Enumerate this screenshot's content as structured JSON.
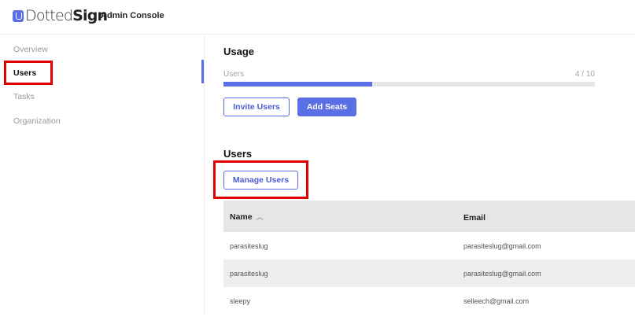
{
  "header": {
    "logo_part1": "Dotted",
    "logo_part2": "Sign",
    "console_label": "Admin Console"
  },
  "sidebar": {
    "items": [
      {
        "label": "Overview",
        "active": false
      },
      {
        "label": "Users",
        "active": true
      },
      {
        "label": "Tasks",
        "active": false
      },
      {
        "label": "Organization",
        "active": false
      }
    ]
  },
  "usage": {
    "title": "Usage",
    "label": "Users",
    "count_text": "4 / 10",
    "fraction": 0.4,
    "invite_button": "Invite Users",
    "add_seats_button": "Add Seats"
  },
  "users_section": {
    "title": "Users",
    "manage_button": "Manage Users",
    "columns": {
      "name": "Name",
      "email": "Email"
    },
    "sort_glyph": "︿",
    "rows": [
      {
        "name": "parasiteslug",
        "email": "parasiteslug@gmail.com"
      },
      {
        "name": "parasiteslug",
        "email": "parasiteslug@gmail.com"
      },
      {
        "name": "sleepy",
        "email": "selleech@gmail.com"
      }
    ]
  },
  "colors": {
    "accent": "#5a6ee6",
    "highlight": "#e00000"
  }
}
